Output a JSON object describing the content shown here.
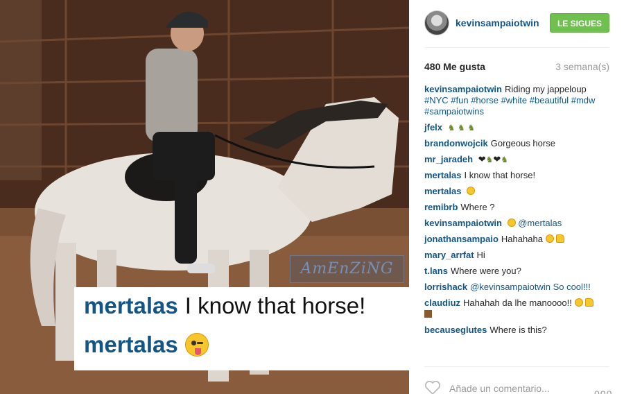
{
  "photo": {
    "watermark": "AmEnZiNG",
    "overlay": {
      "line1_user": "mertalas",
      "line1_text": "I know that horse!",
      "line2_user": "mertalas",
      "line2_emoji": "winking-face-with-tongue-icon"
    }
  },
  "header": {
    "username": "kevinsampaiotwin",
    "follow_label": "LE SIGUES"
  },
  "stats": {
    "likes": "480 Me gusta",
    "age": "3 semana(s)"
  },
  "comments": [
    {
      "user": "kevinsampaiotwin",
      "text": "Riding my jappeloup",
      "tags": "#NYC #fun #horse #white #beautiful #mdw #sampaiotwins"
    },
    {
      "user": "jfelx",
      "text": "",
      "emoji": "horse horse horse"
    },
    {
      "user": "brandonwojcik",
      "text": "Gorgeous horse"
    },
    {
      "user": "mr_jaradeh",
      "text": "",
      "emoji": "heart horse heart horse"
    },
    {
      "user": "mertalas",
      "text": "I know that horse!"
    },
    {
      "user": "mertalas",
      "text": "",
      "emoji": "smile",
      "highlight": true
    },
    {
      "user": "remibrb",
      "text": "Where ?",
      "highlight": true
    },
    {
      "user": "kevinsampaiotwin",
      "text": "@mertalas",
      "emoji": "smile",
      "highlight": true
    },
    {
      "user": "jonathansampaio",
      "text": "Hahahaha",
      "emoji": "smile thumb",
      "highlight": true
    },
    {
      "user": "mary_arrfat",
      "text": "Hi"
    },
    {
      "user": "t.lans",
      "text": "Where were you?"
    },
    {
      "user": "lorrishack",
      "text": "@kevinsampaiotwin So cool!!!"
    },
    {
      "user": "claudiuz",
      "text": "Hahahah da lhe manoooo!!",
      "emoji": "smile thumb square"
    },
    {
      "user": "becauseglutes",
      "text": "Where is this?"
    }
  ],
  "footer": {
    "add_comment_placeholder": "Añade un comentario...",
    "more_label": "ooo"
  },
  "colors": {
    "username": "#125688",
    "follow_bg": "#70c050",
    "highlight": "#fbfb9a"
  }
}
